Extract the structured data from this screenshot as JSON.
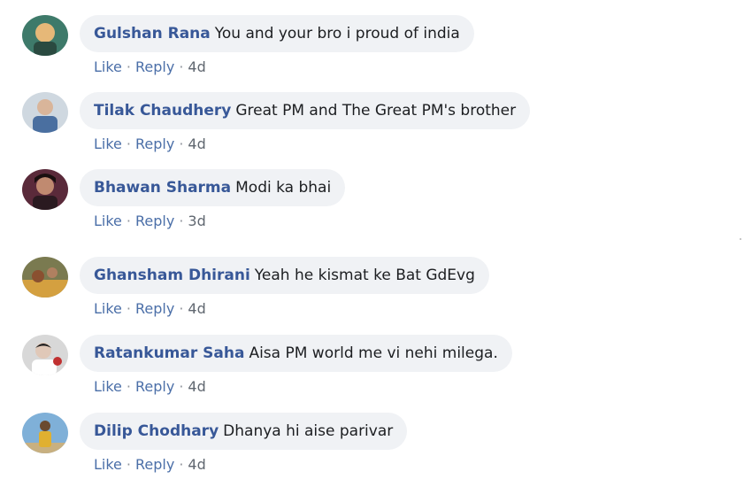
{
  "comments": [
    {
      "author": "Gulshan Rana",
      "text": "You and your bro i proud of india",
      "like": "Like",
      "reply": "Reply",
      "time": "4d",
      "avatar_colors": [
        "#3e7a6a",
        "#e6b878"
      ]
    },
    {
      "author": "Tilak Chaudhery",
      "text": "Great PM and The Great PM's brother",
      "like": "Like",
      "reply": "Reply",
      "time": "4d",
      "avatar_colors": [
        "#4a6fa0",
        "#d9b59a"
      ]
    },
    {
      "author": "Bhawan Sharma",
      "text": "Modi ka bhai",
      "like": "Like",
      "reply": "Reply",
      "time": "3d",
      "avatar_colors": [
        "#5a2a3a",
        "#c08a70"
      ]
    },
    {
      "author": "Ghansham Dhirani",
      "text": "Yeah he kismat ke Bat GdEvg",
      "like": "Like",
      "reply": "Reply",
      "time": "4d",
      "avatar_colors": [
        "#7a7a50",
        "#d4a040"
      ]
    },
    {
      "author": "Ratankumar Saha",
      "text": "Aisa PM world me vi nehi milega.",
      "like": "Like",
      "reply": "Reply",
      "time": "4d",
      "avatar_colors": [
        "#b0b0b0",
        "#e0c8b8"
      ]
    },
    {
      "author": "Dilip Chodhary",
      "text": "Dhanya hi aise parivar",
      "like": "Like",
      "reply": "Reply",
      "time": "4d",
      "avatar_colors": [
        "#7fb0d8",
        "#e0b030"
      ]
    }
  ],
  "separator": "·"
}
